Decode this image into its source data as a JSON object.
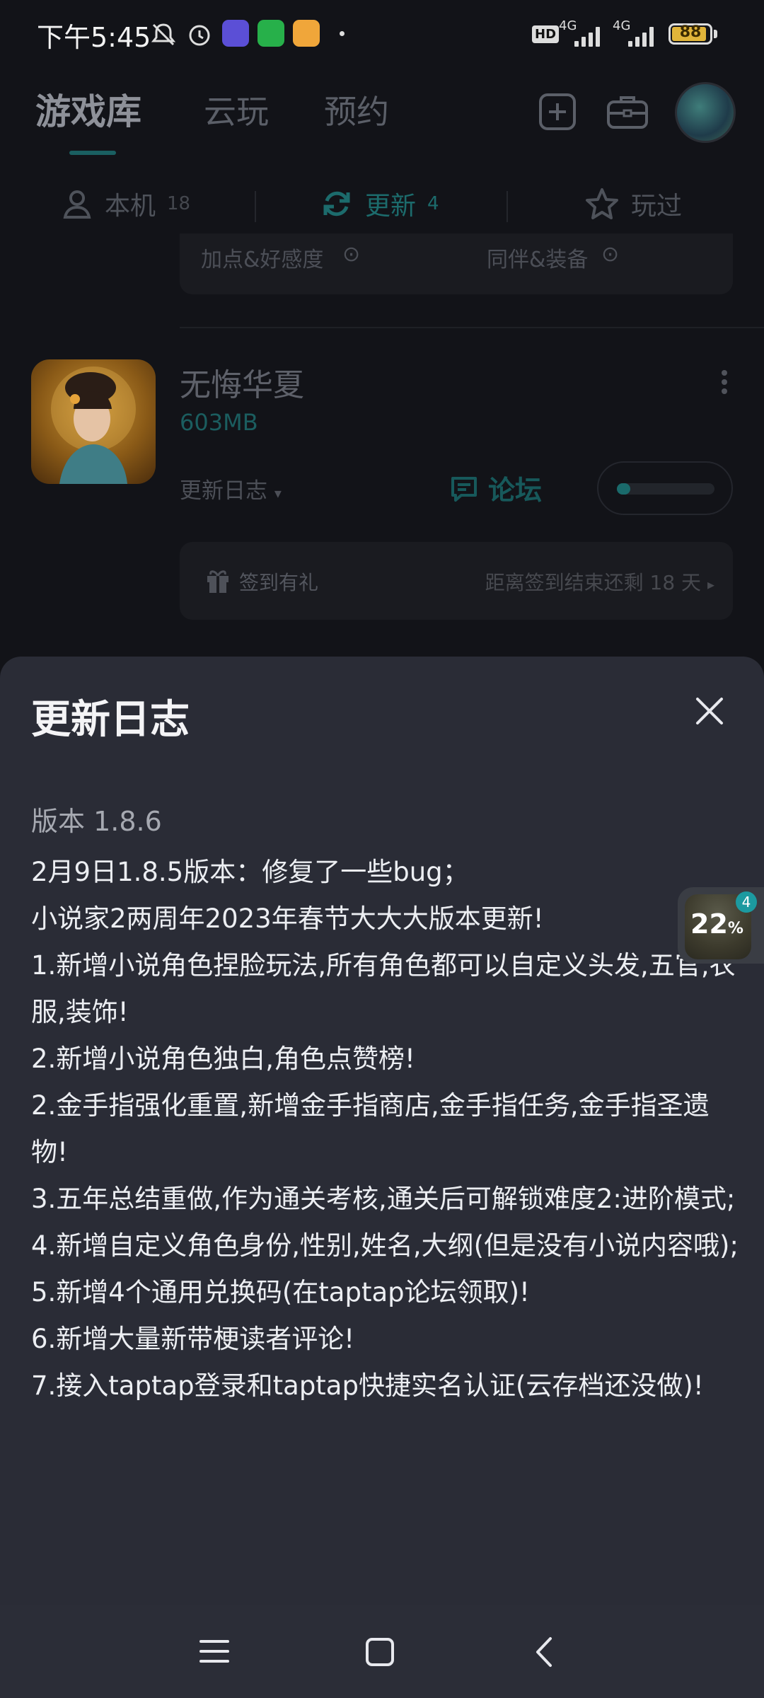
{
  "status_bar": {
    "time": "下午5:45",
    "network_labels": [
      "HD",
      "4G",
      "4G"
    ],
    "battery": "88"
  },
  "header": {
    "tabs": [
      {
        "label": "游戏库",
        "active": true
      },
      {
        "label": "云玩",
        "active": false
      },
      {
        "label": "预约",
        "active": false
      }
    ],
    "icons": [
      "add-icon",
      "toolbox-icon",
      "avatar"
    ]
  },
  "sub_tabs": [
    {
      "label": "本机",
      "count": "18",
      "icon": "user-icon"
    },
    {
      "label": "更新",
      "count": "4",
      "icon": "refresh-icon",
      "active": true
    },
    {
      "label": "玩过",
      "count": "",
      "icon": "star-icon"
    }
  ],
  "prev_card": {
    "link1": "加点&好感度",
    "link2": "同伴&装备"
  },
  "game": {
    "name": "无悔华夏",
    "size": "603MB",
    "changelog_label": "更新日志",
    "forum_label": "论坛",
    "download_progress": 0.14
  },
  "signin": {
    "label": "签到有礼",
    "remaining": "距离签到结束还剩 18 天"
  },
  "sheet": {
    "title": "更新日志",
    "version": "版本 1.8.6",
    "notes": [
      "2月9日1.8.5版本：修复了一些bug；",
      "小说家2两周年2023年春节大大大版本更新!",
      "1.新增小说角色捏脸玩法,所有角色都可以自定义头发,五官,衣服,装饰!",
      "2.新增小说角色独白,角色点赞榜!",
      "2.金手指强化重置,新增金手指商店,金手指任务,金手指圣遗物!",
      "3.五年总结重做,作为通关考核,通关后可解锁难度2:进阶模式;",
      "4.新增自定义角色身份,性别,姓名,大纲(但是没有小说内容哦);",
      "5.新增4个通用兑换码(在taptap论坛领取)!",
      "6.新增大量新带梗读者评论!",
      "7.接入taptap登录和taptap快捷实名认证(云存档还没做)!"
    ]
  },
  "floating_widget": {
    "percent": "22",
    "percent_sign": "%",
    "badge": "4"
  },
  "colors": {
    "background": "#121318",
    "sheet": "#2a2c36",
    "accent": "#1c6b6c"
  }
}
